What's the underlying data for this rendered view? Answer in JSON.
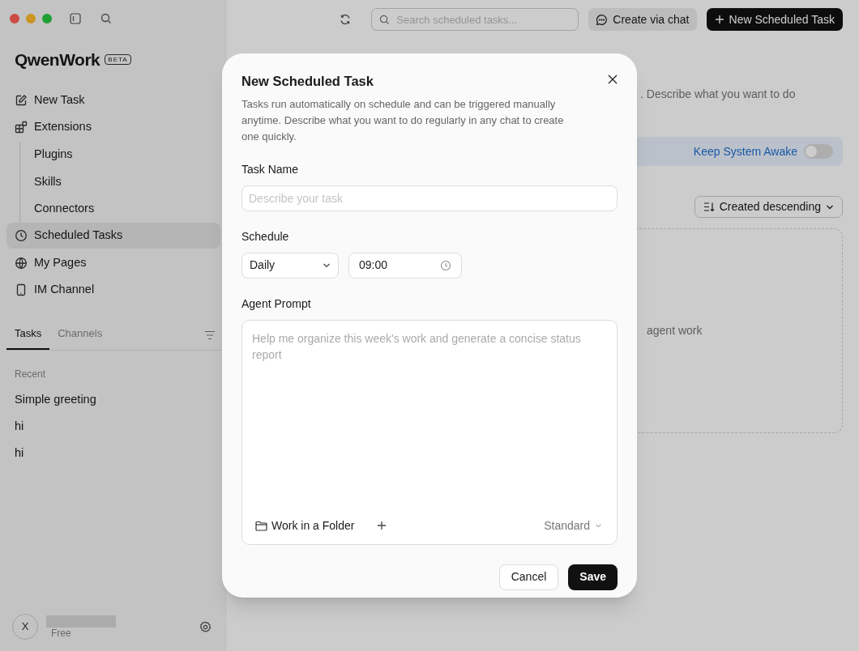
{
  "app": {
    "name": "QwenWork",
    "badge": "BETA"
  },
  "sidebar": {
    "items": [
      {
        "label": "New Task",
        "selected": false
      },
      {
        "label": "Extensions",
        "selected": false,
        "children": [
          {
            "label": "Plugins",
            "selected": false
          },
          {
            "label": "Skills",
            "selected": false
          },
          {
            "label": "Connectors",
            "selected": false
          }
        ]
      },
      {
        "label": "Scheduled Tasks",
        "selected": true
      },
      {
        "label": "My Pages",
        "selected": false
      },
      {
        "label": "IM Channel",
        "selected": false
      }
    ],
    "tabs": [
      {
        "label": "Tasks",
        "selected": true
      },
      {
        "label": "Channels",
        "selected": false
      }
    ],
    "section": "Recent",
    "tasks": [
      "Simple greeting",
      "hi",
      "hi"
    ],
    "user": {
      "initial": "X",
      "plan": "Free"
    }
  },
  "toolbar": {
    "search_placeholder": "Search scheduled tasks...",
    "create_via_chat": "Create via chat",
    "new_task": "New Scheduled Task"
  },
  "page": {
    "description": ". Describe what you want to do",
    "keep_awake": {
      "label": "Keep System Awake",
      "on": false
    },
    "sort": "Created descending",
    "empty_text": "agent work"
  },
  "dialog": {
    "title": "New Scheduled Task",
    "description": "Tasks run automatically on schedule and can be triggered manually anytime. Describe what you want to do regularly in any chat to create one quickly.",
    "task_name": {
      "label": "Task Name",
      "placeholder": "Describe your task"
    },
    "schedule": {
      "label": "Schedule",
      "frequency": "Daily",
      "time": "09:00"
    },
    "prompt": {
      "label": "Agent Prompt",
      "placeholder": "Help me organize this week's work and generate a concise status report",
      "folder": "Work in a Folder",
      "mode": "Standard"
    },
    "buttons": {
      "cancel": "Cancel",
      "save": "Save"
    }
  }
}
